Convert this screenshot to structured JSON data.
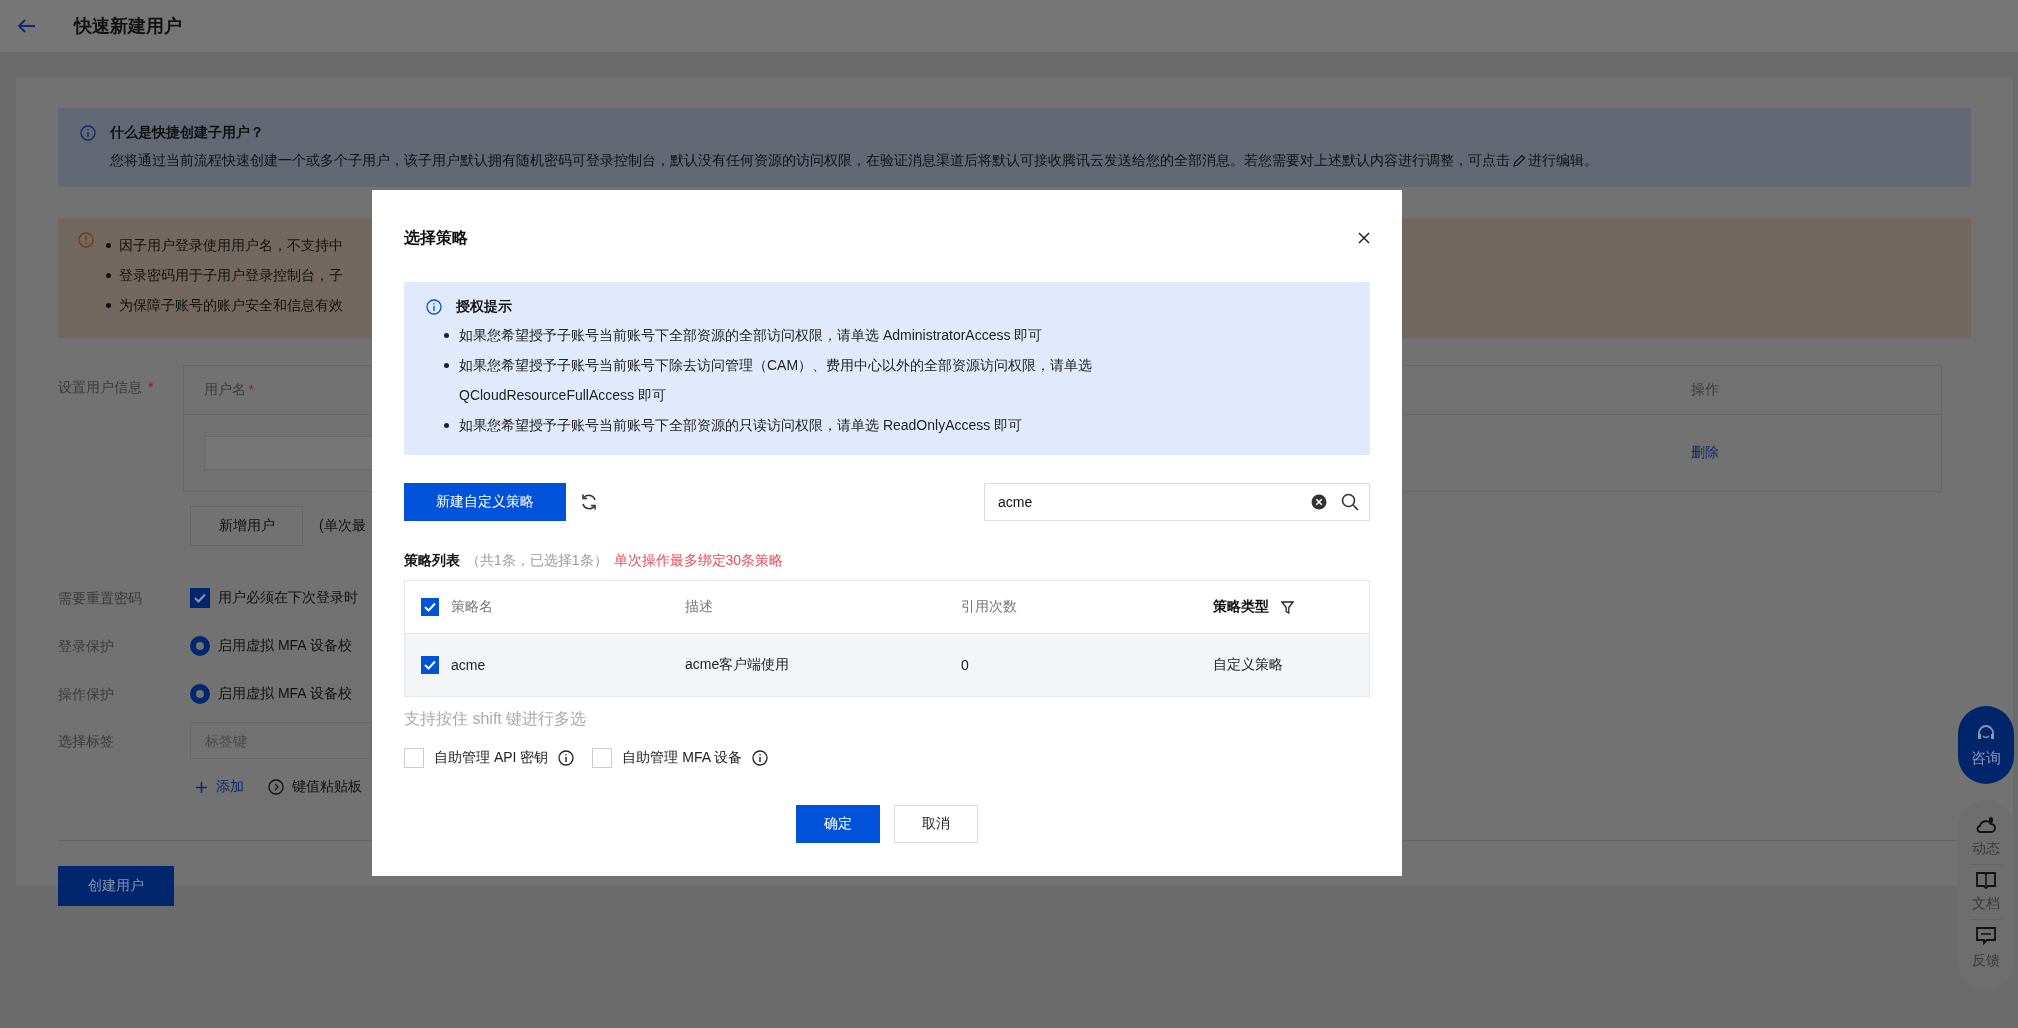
{
  "header": {
    "title": "快速新建用户"
  },
  "info_banner": {
    "title": "什么是快捷创建子用户？",
    "text": "您将通过当前流程快速创建一个或多个子用户，该子用户默认拥有随机密码可登录控制台，默认没有任何资源的访问权限，在验证消息渠道后将默认可接收腾讯云发送给您的全部消息。若您需要对上述默认内容进行调整，可点击",
    "text_after_icon": "进行编辑。"
  },
  "warning_banner": {
    "items": [
      "因子用户登录使用用户名，不支持中",
      "登录密码用于子用户登录控制台，子",
      "为保障子账号的账户安全和信息有效"
    ]
  },
  "user_info": {
    "label": "设置用户信息",
    "required_mark": "*",
    "columns": [
      {
        "title": "用户名",
        "required_mark": "*"
      },
      {
        "title": "操作"
      }
    ],
    "rows": [
      {
        "action": "删除"
      }
    ],
    "add_button": "新增用户",
    "add_note": "(单次最"
  },
  "reset_password": {
    "label": "需要重置密码",
    "checkbox": {
      "label": "用户必须在下次登录时",
      "checked": true
    }
  },
  "login_protection": {
    "label": "登录保护",
    "option": {
      "label": "启用虚拟 MFA 设备校",
      "selected": true
    }
  },
  "operation_protection": {
    "label": "操作保护",
    "option": {
      "label": "启用虚拟 MFA 设备校",
      "selected": true
    }
  },
  "tags": {
    "label": "选择标签",
    "placeholder": "标签键",
    "add_link": "添加",
    "paste_link": "键值粘贴板"
  },
  "submit_button": "创建用户",
  "modal": {
    "title": "选择策略",
    "tip": {
      "title": "授权提示",
      "items": [
        "如果您希望授予子账号当前账号下全部资源的全部访问权限，请单选 AdministratorAccess 即可",
        "如果您希望授予子账号当前账号下除去访问管理（CAM）、费用中心以外的全部资源访问权限，请单选\nQCloudResourceFullAccess 即可",
        "如果您希望授予子账号当前账号下全部资源的只读访问权限，请单选 ReadOnlyAccess 即可"
      ]
    },
    "new_button": "新建自定义策略",
    "search": {
      "value": "acme"
    },
    "list_title": "策略列表",
    "list_count": "（共1条，已选择1条）",
    "list_limit": "单次操作最多绑定30条策略",
    "table": {
      "all_checked": true,
      "columns": [
        {
          "title": "策略名",
          "filter": false
        },
        {
          "title": "描述",
          "filter": false
        },
        {
          "title": "引用次数",
          "filter": false
        },
        {
          "title": "策略类型",
          "filter": true
        }
      ],
      "rows": [
        {
          "checked": true,
          "cells": [
            "acme",
            "acme客户端使用",
            "0",
            "自定义策略"
          ]
        }
      ]
    },
    "hint": "支持按住 shift 键进行多选",
    "options": [
      {
        "label": "自助管理 API 密钥",
        "checked": false
      },
      {
        "label": "自助管理 MFA 设备",
        "checked": false
      }
    ],
    "buttons": [
      {
        "label": "确定",
        "kind": "primary"
      },
      {
        "label": "取消",
        "kind": "secondary"
      }
    ]
  },
  "float_toolbar": {
    "consult": "咨询",
    "items": [
      {
        "label": "动态",
        "kind": "cloud"
      },
      {
        "label": "文档",
        "kind": "book"
      },
      {
        "label": "反馈",
        "kind": "chat"
      }
    ]
  }
}
